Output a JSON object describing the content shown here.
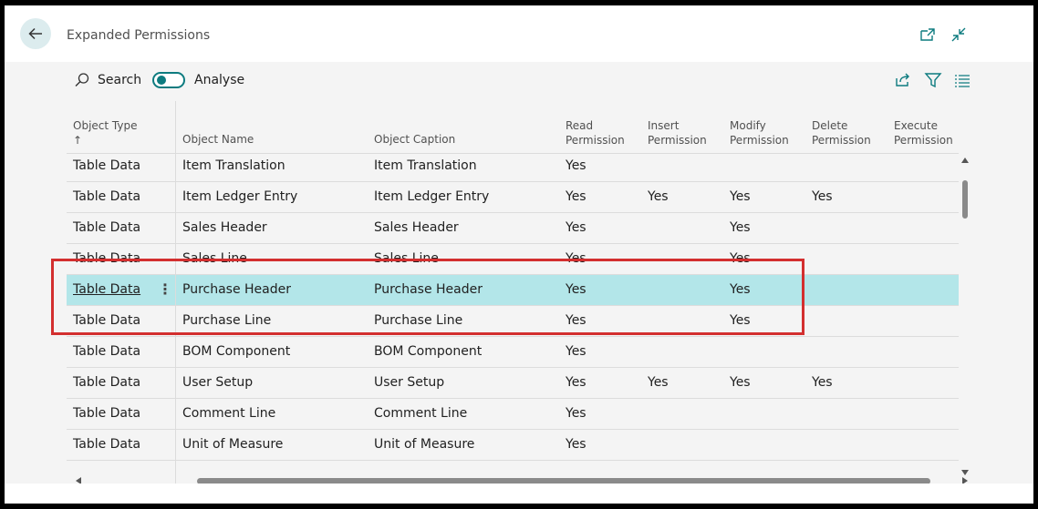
{
  "header": {
    "title": "Expanded Permissions"
  },
  "toolbar": {
    "search_label": "Search",
    "analyse_label": "Analyse"
  },
  "columns": {
    "object_type": "Object Type",
    "sort_arrow": "↑",
    "object_name": "Object Name",
    "object_caption": "Object Caption",
    "read_1": "Read",
    "read_2": "Permission",
    "insert_1": "Insert",
    "insert_2": "Permission",
    "modify_1": "Modify",
    "modify_2": "Permission",
    "delete_1": "Delete",
    "delete_2": "Permission",
    "execute_1": "Execute",
    "execute_2": "Permission"
  },
  "rows": [
    {
      "type": "Table Data",
      "name": "Item Translation",
      "caption": "Item Translation",
      "read": "Yes",
      "insert": "",
      "modify": "",
      "delete": "",
      "execute": ""
    },
    {
      "type": "Table Data",
      "name": "Item Ledger Entry",
      "caption": "Item Ledger Entry",
      "read": "Yes",
      "insert": "Yes",
      "modify": "Yes",
      "delete": "Yes",
      "execute": ""
    },
    {
      "type": "Table Data",
      "name": "Sales Header",
      "caption": "Sales Header",
      "read": "Yes",
      "insert": "",
      "modify": "Yes",
      "delete": "",
      "execute": ""
    },
    {
      "type": "Table Data",
      "name": "Sales Line",
      "caption": "Sales Line",
      "read": "Yes",
      "insert": "",
      "modify": "Yes",
      "delete": "",
      "execute": ""
    },
    {
      "type": "Table Data",
      "name": "Purchase Header",
      "caption": "Purchase Header",
      "read": "Yes",
      "insert": "",
      "modify": "Yes",
      "delete": "",
      "execute": ""
    },
    {
      "type": "Table Data",
      "name": "Purchase Line",
      "caption": "Purchase Line",
      "read": "Yes",
      "insert": "",
      "modify": "Yes",
      "delete": "",
      "execute": ""
    },
    {
      "type": "Table Data",
      "name": "BOM Component",
      "caption": "BOM Component",
      "read": "Yes",
      "insert": "",
      "modify": "",
      "delete": "",
      "execute": ""
    },
    {
      "type": "Table Data",
      "name": "User Setup",
      "caption": "User Setup",
      "read": "Yes",
      "insert": "Yes",
      "modify": "Yes",
      "delete": "Yes",
      "execute": ""
    },
    {
      "type": "Table Data",
      "name": "Comment Line",
      "caption": "Comment Line",
      "read": "Yes",
      "insert": "",
      "modify": "",
      "delete": "",
      "execute": ""
    },
    {
      "type": "Table Data",
      "name": "Unit of Measure",
      "caption": "Unit of Measure",
      "read": "Yes",
      "insert": "",
      "modify": "",
      "delete": "",
      "execute": ""
    }
  ],
  "colors": {
    "accent": "#0d7b7f",
    "selected_row": "#b3e6e9",
    "highlight_box": "#d32f2f"
  }
}
